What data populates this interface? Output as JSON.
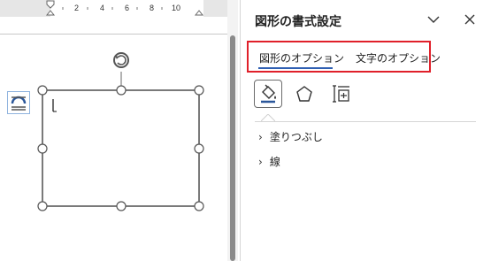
{
  "ruler": {
    "ticks": [
      "2",
      "4",
      "6",
      "8",
      "10"
    ]
  },
  "pane": {
    "title": "図形の書式設定",
    "tabs": [
      {
        "label": "図形のオプション",
        "active": true
      },
      {
        "label": "文字のオプション",
        "active": false
      }
    ],
    "icons": [
      "fill-line-icon",
      "effects-pentagon-icon",
      "size-properties-icon"
    ],
    "sections": [
      {
        "label": "塗りつぶし"
      },
      {
        "label": "線"
      }
    ]
  },
  "colors": {
    "highlight_box": "#e0202a",
    "active_underline": "#2f5fb2"
  }
}
